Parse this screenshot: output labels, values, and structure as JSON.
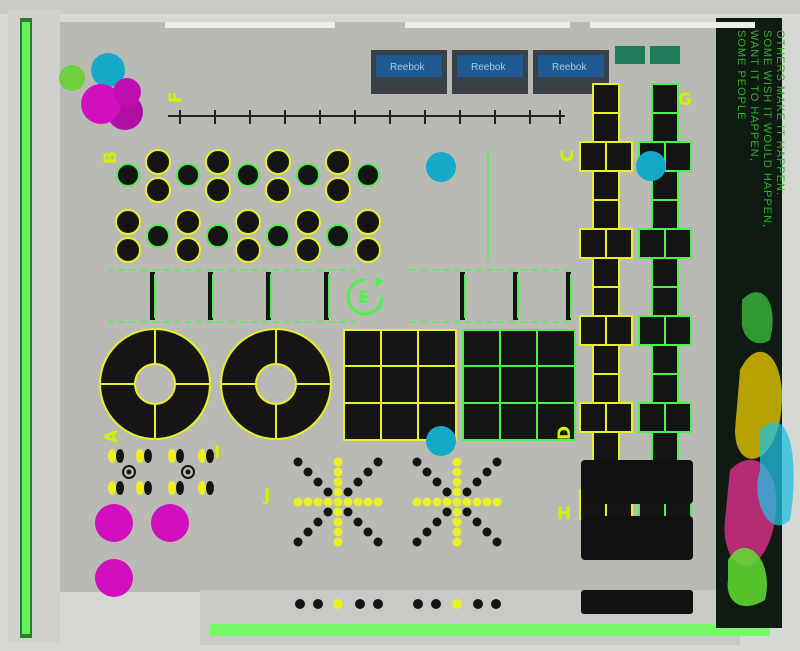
{
  "colors": {
    "floor": "#b9bab4",
    "wall": "#d6d8d3",
    "accent_green": "#4ef04e",
    "accent_yellow": "#e8f028",
    "black": "#141414",
    "teal_ball": "#14a9c9",
    "magenta_ball": "#d10fbf"
  },
  "zones": {
    "A": {
      "label": "A"
    },
    "B": {
      "label": "B"
    },
    "C": {
      "label": "C"
    },
    "D": {
      "label": "D"
    },
    "E": {
      "label": "E"
    },
    "F": {
      "label": "F"
    },
    "G": {
      "label": "G"
    },
    "H": {
      "label": "H"
    },
    "I": {
      "label": "I"
    },
    "J": {
      "label": "J"
    }
  },
  "equipment": {
    "storage_brand": [
      "Reebok",
      "Reebok",
      "Reebok"
    ]
  },
  "mural": {
    "lines": [
      "SOME PEOPLE",
      "WANT IT TO HAPPEN,",
      "SOME WISH IT WOULD HAPPEN,",
      "OTHERS MAKE IT HAPPEN."
    ]
  },
  "icons": {
    "teal_ball": "medicine-ball-icon",
    "magenta_ball": "stability-ball-icon",
    "circle_target": "target-circle-icon",
    "hurdle": "agility-hurdle-icon",
    "footprint": "footprint-icon"
  }
}
